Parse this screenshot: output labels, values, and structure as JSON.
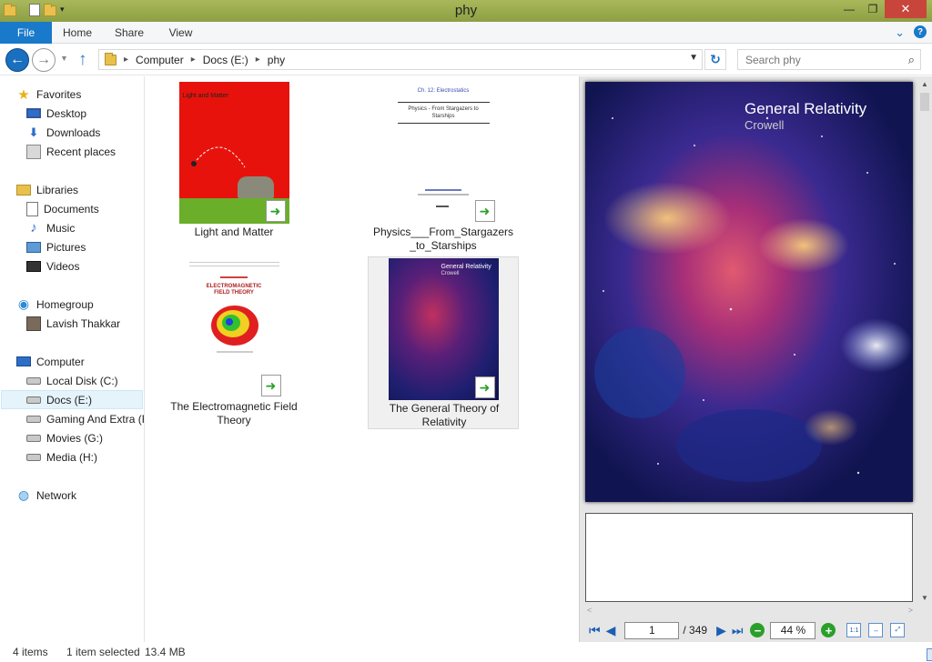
{
  "window": {
    "title": "phy"
  },
  "ribbon": {
    "tabs": [
      "File",
      "Home",
      "Share",
      "View"
    ]
  },
  "address": {
    "crumbs": [
      "Computer",
      "Docs (E:)",
      "phy"
    ],
    "search_placeholder": "Search phy"
  },
  "nav": {
    "favorites": {
      "label": "Favorites",
      "items": [
        "Desktop",
        "Downloads",
        "Recent places"
      ]
    },
    "libraries": {
      "label": "Libraries",
      "items": [
        "Documents",
        "Music",
        "Pictures",
        "Videos"
      ]
    },
    "homegroup": {
      "label": "Homegroup",
      "items": [
        "Lavish Thakkar"
      ]
    },
    "computer": {
      "label": "Computer",
      "items": [
        "Local Disk (C:)",
        "Docs (E:)",
        "Gaming And Extra (F",
        "Movies (G:)",
        "Media (H:)"
      ],
      "selected": "Docs (E:)"
    },
    "network": {
      "label": "Network"
    }
  },
  "files": [
    {
      "name": "Light and Matter",
      "cover_title": "Light and Matter"
    },
    {
      "name": "Physics___From_Stargazers_to_Starships",
      "cover_head": "Ch. 12: Electrostatics",
      "cover_title": "Physics - From Stargazers to Starships"
    },
    {
      "name": "The Electromagnetic Field Theory",
      "cover_title": "ELECTROMAGNETIC FIELD THEORY"
    },
    {
      "name": "The General Theory of Relativity",
      "cover_title": "General Relativity",
      "cover_author": "Crowell"
    }
  ],
  "preview": {
    "title": "General Relativity",
    "author": "Crowell",
    "page": "1",
    "page_count": "/ 349",
    "zoom": "44 %"
  },
  "status": {
    "items": "4 items",
    "selection": "1 item selected",
    "size": "13.4 MB"
  },
  "colors": {
    "accent": "#1979ca",
    "titlebar": "#9aab4f",
    "close": "#c7453b"
  }
}
